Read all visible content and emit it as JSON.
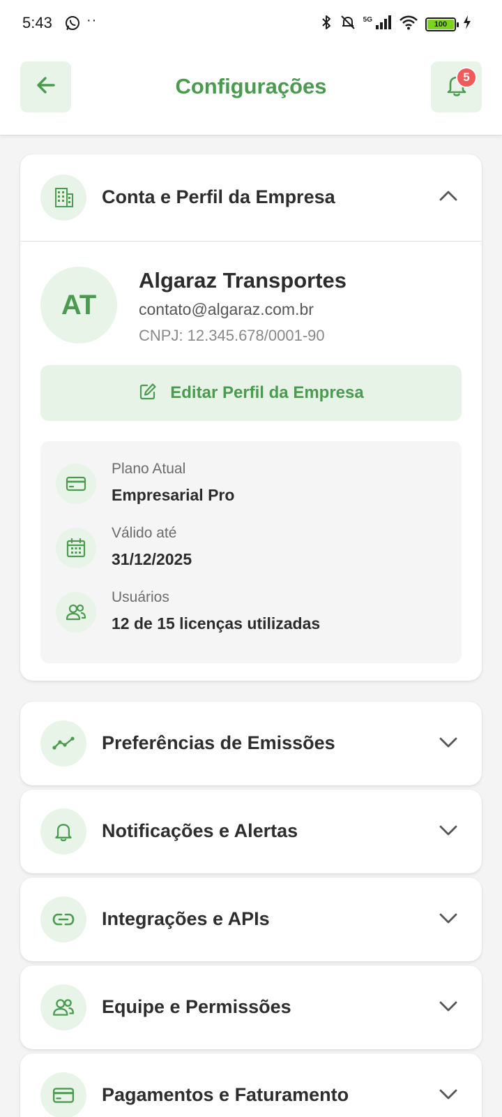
{
  "status_bar": {
    "time": "5:43",
    "dots": "··",
    "network": "5G",
    "battery": "100"
  },
  "header": {
    "title": "Configurações",
    "notification_count": "5"
  },
  "company_section": {
    "title": "Conta e Perfil da Empresa",
    "avatar_initials": "AT",
    "company_name": "Algaraz Transportes",
    "email": "contato@algaraz.com.br",
    "cnpj": "CNPJ: 12.345.678/0001-90",
    "edit_button": "Editar Perfil da Empresa",
    "plan_rows": [
      {
        "label": "Plano Atual",
        "value": "Empresarial Pro",
        "icon": "credit-card-icon"
      },
      {
        "label": "Válido até",
        "value": "31/12/2025",
        "icon": "calendar-icon"
      },
      {
        "label": "Usuários",
        "value": "12 de 15 licenças utilizadas",
        "icon": "users-icon"
      }
    ]
  },
  "sections": [
    {
      "title": "Preferências de Emissões",
      "icon": "trend-line-icon"
    },
    {
      "title": "Notificações e Alertas",
      "icon": "bell-icon"
    },
    {
      "title": "Integrações e APIs",
      "icon": "link-icon"
    },
    {
      "title": "Equipe e Permissões",
      "icon": "users-icon"
    },
    {
      "title": "Pagamentos e Faturamento",
      "icon": "credit-card-icon"
    }
  ],
  "colors": {
    "brand_green": "#4a9a4f",
    "light_green": "#e8f4e8",
    "badge_red": "#f05a5a",
    "background": "#f4f4f4"
  }
}
